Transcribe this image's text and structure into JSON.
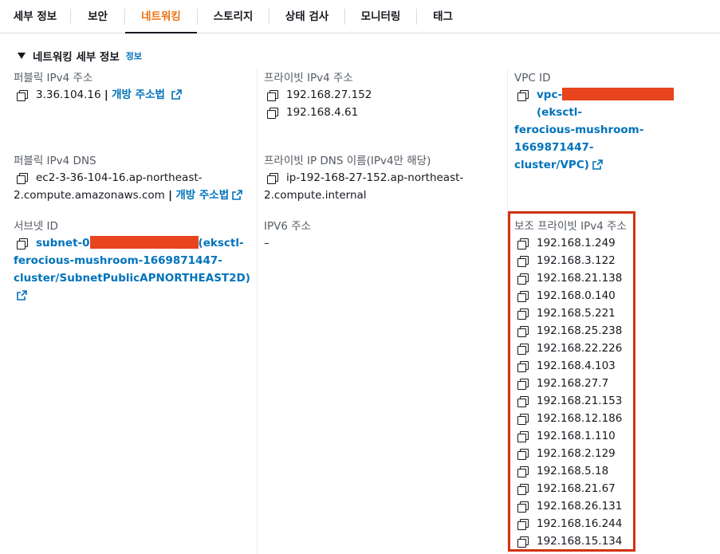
{
  "tabs": [
    {
      "label": "세부 정보",
      "active": false
    },
    {
      "label": "보안",
      "active": false
    },
    {
      "label": "네트워킹",
      "active": true
    },
    {
      "label": "스토리지",
      "active": false
    },
    {
      "label": "상태 검사",
      "active": false
    },
    {
      "label": "모니터링",
      "active": false
    },
    {
      "label": "태그",
      "active": false
    }
  ],
  "section": {
    "title": "네트워킹 세부 정보",
    "info_link": "정보"
  },
  "public_ipv4": {
    "label": "퍼블릭 IPv4 주소",
    "value": "3.36.104.16",
    "separator": "|",
    "link": "개방 주소법"
  },
  "private_ipv4": {
    "label": "프라이빗 IPv4 주소",
    "values": [
      "192.168.27.152",
      "192.168.4.61"
    ]
  },
  "vpc": {
    "label": "VPC ID",
    "prefix": "vpc-",
    "suffix_line1": "(eksctl-",
    "line2": "ferocious-mushroom-1669871447-",
    "line3": "cluster/VPC)"
  },
  "public_dns": {
    "label": "퍼블릭 IPv4 DNS",
    "line1": "ec2-3-36-104-16.ap-northeast-",
    "line2": "2.compute.amazonaws.com",
    "separator": "|",
    "link": "개방 주소법"
  },
  "private_dns": {
    "label": "프라이빗 IP DNS 이름(IPv4만 해당)",
    "line1": "ip-192-168-27-152.ap-northeast-",
    "line2": "2.compute.internal"
  },
  "subnet": {
    "label": "서브넷 ID",
    "prefix": "subnet-0",
    "suffix_line1": "(eksctl-",
    "line2": "ferocious-mushroom-1669871447-",
    "line3": "cluster/SubnetPublicAPNORTHEAST2D)"
  },
  "ipv6": {
    "label": "IPV6 주소",
    "value": "–"
  },
  "secondary_ipv4": {
    "label": "보조 프라이빗 IPv4 주소",
    "values": [
      "192.168.1.249",
      "192.168.3.122",
      "192.168.21.138",
      "192.168.0.140",
      "192.168.5.221",
      "192.168.25.238",
      "192.168.22.226",
      "192.168.4.103",
      "192.168.27.7",
      "192.168.21.153",
      "192.168.12.186",
      "192.168.1.110",
      "192.168.2.129",
      "192.168.5.18",
      "192.168.21.67",
      "192.168.26.131",
      "192.168.16.244",
      "192.168.15.134"
    ]
  },
  "colors": {
    "link": "#0073bb",
    "active_tab": "#ec7211",
    "redaction": "#e8441d",
    "highlight": "#d13212"
  }
}
